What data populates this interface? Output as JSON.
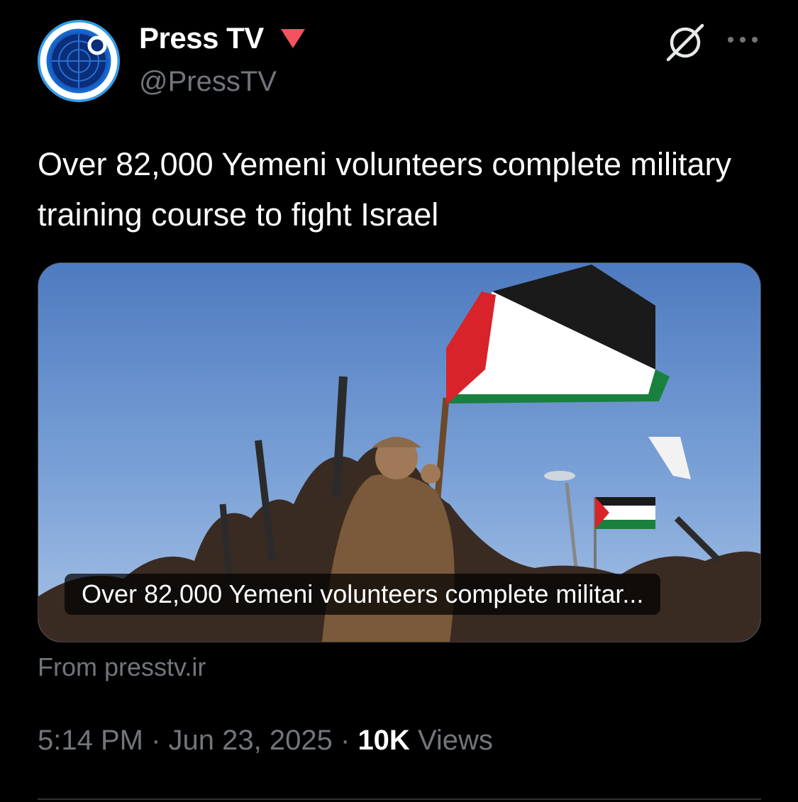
{
  "author": {
    "display_name": "Press TV",
    "handle": "@PressTV",
    "badge_color": "#f4525f",
    "badge_icon": "red-downward-triangle-icon",
    "avatar_icon": "presstv-logo-icon"
  },
  "header_actions": {
    "grok_icon": "grok-icon",
    "more_icon": "more-dots-icon"
  },
  "tweet": {
    "text": "Over 82,000 Yemeni volunteers complete military training course to fight Israel"
  },
  "link_card": {
    "caption": "Over 82,000 Yemeni volunteers complete militar...",
    "source": "From presstv.ir"
  },
  "meta": {
    "time": "5:14 PM",
    "separator": "·",
    "date": "Jun 23, 2025",
    "views_count": "10K",
    "views_label": "Views"
  },
  "colors": {
    "background": "#000000",
    "primary_text": "#ffffff",
    "secondary_text": "#71767b",
    "divider": "#2f3336"
  }
}
